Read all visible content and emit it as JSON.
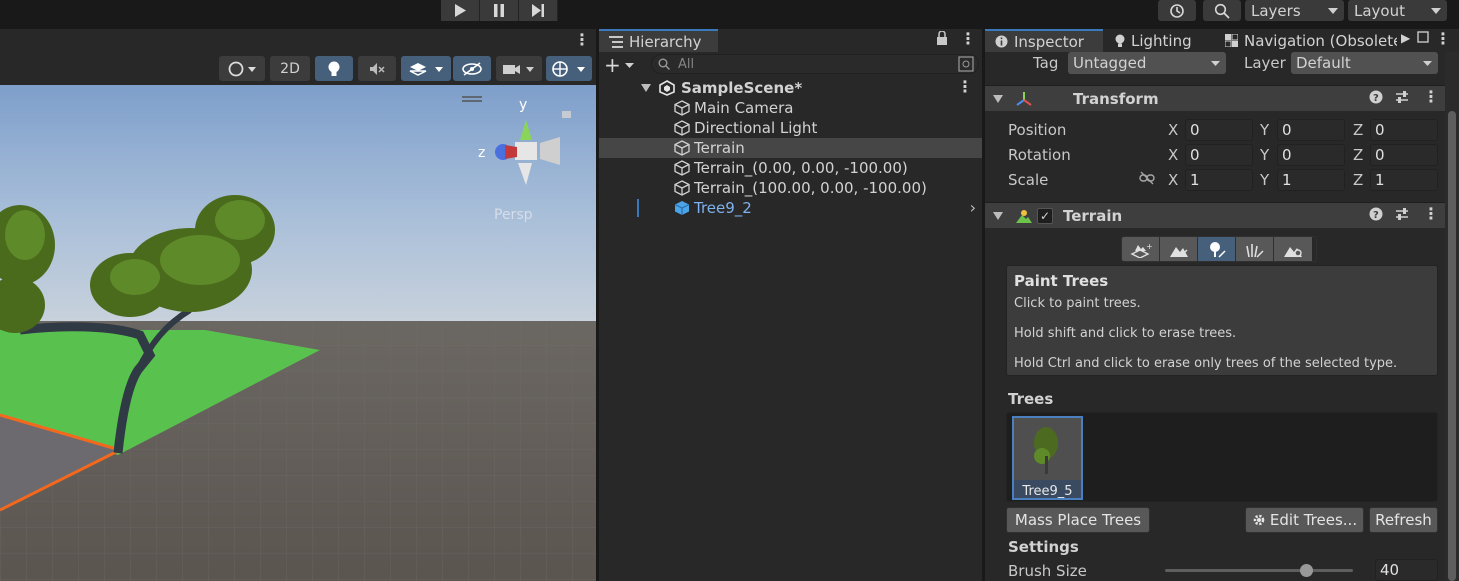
{
  "topbar": {
    "layers_label": "Layers",
    "layout_label": "Layout"
  },
  "scene": {
    "toolbar": {
      "btn_2d": "2D"
    },
    "gizmo": {
      "y_label": "y",
      "z_label": "z",
      "persp_label": "Persp"
    }
  },
  "hierarchy": {
    "tab_label": "Hierarchy",
    "search_placeholder": "All",
    "scene_name": "SampleScene*",
    "items": [
      {
        "label": "Main Camera"
      },
      {
        "label": "Directional Light"
      },
      {
        "label": "Terrain"
      },
      {
        "label": "Terrain_(0.00, 0.00, -100.00)"
      },
      {
        "label": "Terrain_(100.00, 0.00, -100.00)"
      },
      {
        "label": "Tree9_2"
      }
    ]
  },
  "inspector": {
    "tabs": {
      "inspector": "Inspector",
      "lighting": "Lighting",
      "navigation": "Navigation (Obsolete"
    },
    "tag_label": "Tag",
    "tag_value": "Untagged",
    "layer_label": "Layer",
    "layer_value": "Default",
    "transform": {
      "title": "Transform",
      "position_label": "Position",
      "rotation_label": "Rotation",
      "scale_label": "Scale",
      "x_label": "X",
      "y_label": "Y",
      "z_label": "Z",
      "position": [
        "0",
        "0",
        "0"
      ],
      "rotation": [
        "0",
        "0",
        "0"
      ],
      "scale": [
        "1",
        "1",
        "1"
      ]
    },
    "terrain": {
      "title": "Terrain",
      "paint_title": "Paint Trees",
      "paint_line1": "Click to paint trees.",
      "paint_line2": "Hold shift and click to erase trees.",
      "paint_line3": "Hold Ctrl and click to erase only trees of the selected type.",
      "trees_label": "Trees",
      "tree_item": "Tree9_5",
      "mass_place": "Mass Place Trees",
      "edit_trees": "Edit Trees...",
      "refresh": "Refresh",
      "settings_label": "Settings",
      "brush_size_label": "Brush Size",
      "brush_size_value": "40",
      "brush_size_fraction": 0.75
    }
  },
  "colors": {
    "accent": "#3a79bb",
    "selection": "#46607c",
    "panel": "#282828",
    "ground_green": "#59c24e",
    "selection_outline": "#f2691e"
  }
}
